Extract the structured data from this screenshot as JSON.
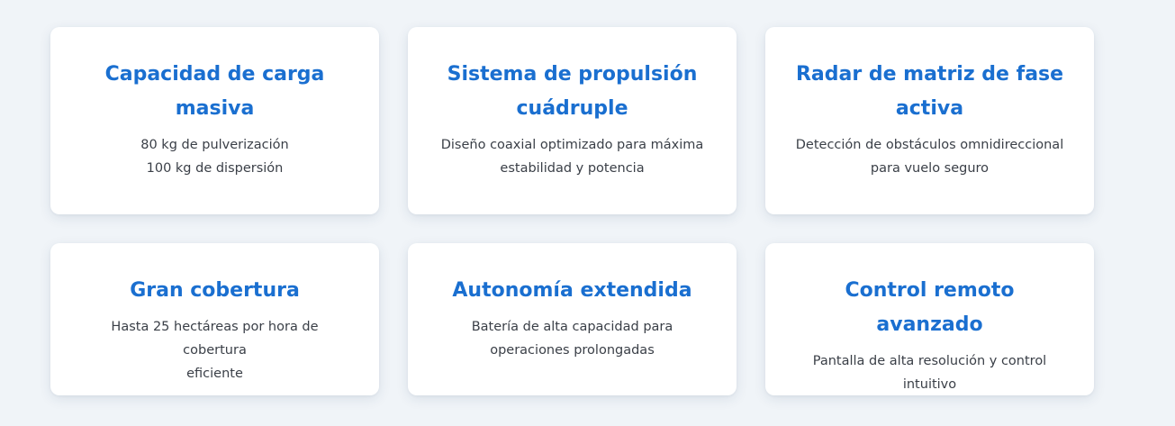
{
  "features": [
    {
      "title": "Capacidad de carga masiva",
      "title_line1": "Capacidad de carga",
      "title_line2": "masiva",
      "desc_line1": "80 kg de pulverización",
      "desc_line2": "100 kg de dispersión"
    },
    {
      "title_line1": "Sistema de propulsión",
      "title_line2": "cuádruple",
      "desc_line1": "Diseño coaxial optimizado para máxima",
      "desc_line2": "estabilidad y potencia"
    },
    {
      "title_line1": "Radar de matriz de fase",
      "title_line2": "activa",
      "desc_line1": "Detección de obstáculos omnidireccional",
      "desc_line2": "para vuelo seguro"
    },
    {
      "title_line1": "Gran cobertura",
      "desc_line1": "Hasta 25 hectáreas por hora de cobertura",
      "desc_line2": "eficiente"
    },
    {
      "title_line1": "Autonomía extendida",
      "desc_line1": "Batería de alta capacidad para",
      "desc_line2": "operaciones prolongadas"
    },
    {
      "title_line1": "Control remoto avanzado",
      "desc_line1": "Pantalla de alta resolución y control",
      "desc_line2": "intuitivo"
    }
  ],
  "colors": {
    "background": "#f0f4f8",
    "card": "#ffffff",
    "title": "#1a6fd0",
    "text": "#3a3f47"
  }
}
